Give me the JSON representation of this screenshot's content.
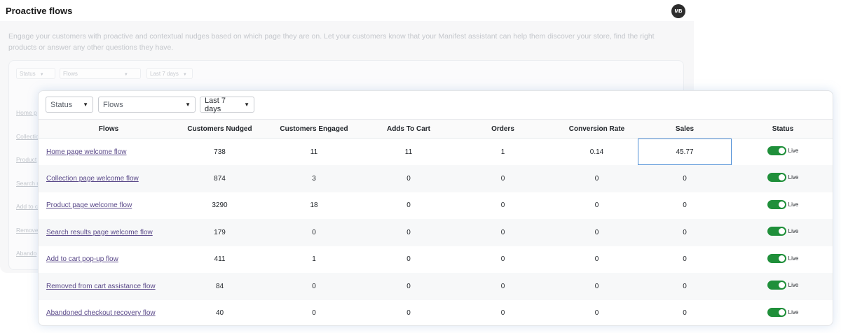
{
  "app": {
    "title": "Proactive flows",
    "avatar_initials": "MB",
    "description": "Engage your customers with proactive and contextual nudges based on which page they are on. Let your customers know that your Manifest assistant can help them discover your store, find the right products or answer any other questions they have."
  },
  "filters": {
    "status": "Status",
    "flows": "Flows",
    "date_range": "Last 7 days"
  },
  "background_rows": [
    "Home p",
    "Collectio",
    "Product",
    "Search r",
    "Add to c",
    "Remove",
    "Abando"
  ],
  "table": {
    "columns": [
      "Flows",
      "Customers Nudged",
      "Customers Engaged",
      "Adds To Cart",
      "Orders",
      "Conversion Rate",
      "Sales",
      "Status"
    ],
    "rows": [
      {
        "flow": "Home page welcome flow",
        "nudged": "738",
        "engaged": "11",
        "adds": "11",
        "orders": "1",
        "conversion": "0.14",
        "sales": "45.77",
        "status": "Live"
      },
      {
        "flow": "Collection page welcome flow",
        "nudged": "874",
        "engaged": "3",
        "adds": "0",
        "orders": "0",
        "conversion": "0",
        "sales": "0",
        "status": "Live"
      },
      {
        "flow": "Product page welcome flow",
        "nudged": "3290",
        "engaged": "18",
        "adds": "0",
        "orders": "0",
        "conversion": "0",
        "sales": "0",
        "status": "Live"
      },
      {
        "flow": "Search results page welcome flow",
        "nudged": "179",
        "engaged": "0",
        "adds": "0",
        "orders": "0",
        "conversion": "0",
        "sales": "0",
        "status": "Live"
      },
      {
        "flow": "Add to cart pop-up flow",
        "nudged": "411",
        "engaged": "1",
        "adds": "0",
        "orders": "0",
        "conversion": "0",
        "sales": "0",
        "status": "Live"
      },
      {
        "flow": "Removed from cart assistance flow",
        "nudged": "84",
        "engaged": "0",
        "adds": "0",
        "orders": "0",
        "conversion": "0",
        "sales": "0",
        "status": "Live"
      },
      {
        "flow": "Abandoned checkout recovery flow",
        "nudged": "40",
        "engaged": "0",
        "adds": "0",
        "orders": "0",
        "conversion": "0",
        "sales": "0",
        "status": "Live"
      }
    ]
  },
  "colors": {
    "toggle_on": "#1f8f3a",
    "link": "#5b4a8a",
    "selection": "#4f8fd6"
  }
}
